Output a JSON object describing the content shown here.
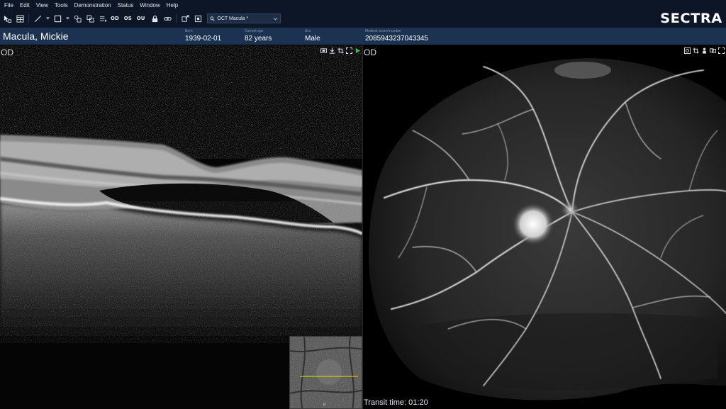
{
  "menu": [
    "File",
    "Edit",
    "View",
    "Tools",
    "Demonstration",
    "Status",
    "Window",
    "Help"
  ],
  "toolbar": {
    "eye_buttons": [
      "OD",
      "OS",
      "OU"
    ],
    "protocol": "OCT Macula *"
  },
  "logo": "SECTRA",
  "patient": {
    "name": "Macula, Mickie",
    "born_label": "Born",
    "born": "1939-02-01",
    "age_label": "Current age",
    "age": "82 years",
    "sex_label": "Sex",
    "sex": "Male",
    "mrn_label": "Medical record number",
    "mrn": "2085943237043345"
  },
  "viewports": {
    "left": {
      "eye": "OD",
      "thumbnail_letter": "F"
    },
    "right": {
      "eye": "OD",
      "transit_time": "Transit time: 01:20"
    }
  },
  "icons": {
    "toolbar": [
      "select-icon",
      "layout-icon",
      "line-tool-icon",
      "rectangle-tool-icon",
      "link-series-icon",
      "sync-icon",
      "lock-icon",
      "chain-link-icon",
      "export-icon",
      "settings-icon",
      "search-icon"
    ],
    "left_viewport": [
      "filmstrip-icon",
      "download-icon",
      "crop-icon",
      "fullscreen-icon",
      "play-icon"
    ],
    "right_viewport": [
      "snapshot-icon",
      "crop-icon",
      "person-icon",
      "compare-icon",
      "fullscreen-icon"
    ]
  },
  "colors": {
    "chrome": "#0c1626",
    "patient_bar": "#1b3250",
    "play_green": "#3bb54a",
    "scan_line": "#e8e000"
  }
}
